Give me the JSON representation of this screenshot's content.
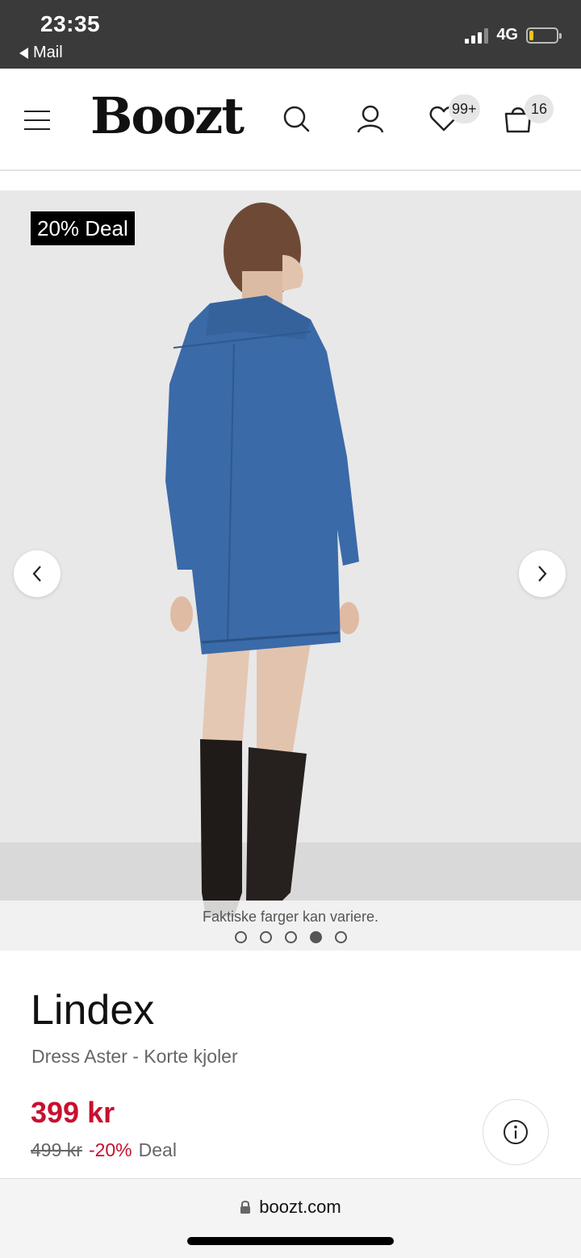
{
  "status_bar": {
    "time": "23:35",
    "back_label": "Mail",
    "network": "4G",
    "battery_level": 0.1
  },
  "header": {
    "logo": "Boozt",
    "wishlist_count": "99+",
    "cart_count": "16",
    "icons": [
      "menu-icon",
      "search-icon",
      "user-icon",
      "heart-icon",
      "bag-icon"
    ]
  },
  "gallery": {
    "deal_tag": "20% Deal",
    "caption": "Faktiske farger kan variere.",
    "image_count": 5,
    "active_index": 3
  },
  "product": {
    "brand": "Lindex",
    "subtitle": "Dress Aster - Korte kjoler",
    "price": "399 kr",
    "old_price": "499 kr",
    "discount": "-20%",
    "deal_label": "Deal"
  },
  "browser": {
    "url": "boozt.com"
  },
  "colors": {
    "sale_red": "#c8102e",
    "status_bar_bg": "#3a3a3a",
    "denim": "#3a6aa8"
  }
}
